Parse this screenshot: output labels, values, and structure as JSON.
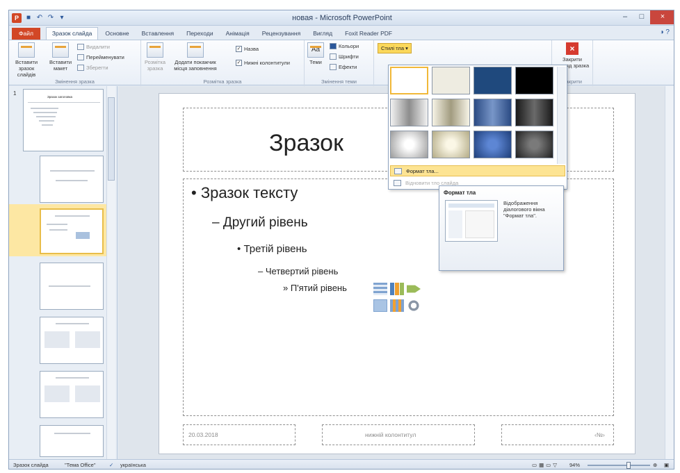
{
  "window": {
    "title": "новая - Microsoft PowerPoint"
  },
  "tabs": [
    "Файл",
    "Зразок слайда",
    "Основне",
    "Вставлення",
    "Переходи",
    "Анімація",
    "Рецензування",
    "Вигляд",
    "Foxit Reader PDF"
  ],
  "ribbon": {
    "insert_master": "Вставити зразок слайдів",
    "insert_layout": "Вставити макет",
    "delete": "Видалити",
    "rename": "Перейменувати",
    "preserve": "Зберегти",
    "group_edit": "Змінення зразка",
    "layout_btn": "Розмітка зразка",
    "insert_placeholder": "Додати покажчик місця заповнення",
    "chk_title": "Назва",
    "chk_footers": "Нижні колонтитули",
    "group_layout": "Розмітка зразка",
    "themes": "Теми",
    "colors": "Кольори",
    "fonts": "Шрифти",
    "effects": "Ефекти",
    "group_theme": "Змінення теми",
    "bg_styles": "Стилі тла",
    "close_view": "Закрити вигляд зразка",
    "group_close": "Закрити"
  },
  "thumbnail": {
    "number": "1",
    "title": "Зразок заголовка"
  },
  "slide": {
    "title": "Зразок",
    "bullets": [
      "Зразок тексту",
      "Другий рівень",
      "Третій рівень",
      "Четвертий рівень",
      "П'ятий рівень"
    ],
    "bullet_marks": [
      "•",
      "–",
      "•",
      "–",
      "»"
    ],
    "date": "20.03.2018",
    "footer": "нижній колонтитул",
    "number": "‹№›"
  },
  "gallery": {
    "format_bg": "Формат тла...",
    "reset_bg": "Відновити тло слайда",
    "swatch_colors": [
      "#ffffff",
      "#eeece1",
      "#1f497d",
      "#000000"
    ]
  },
  "tooltip": {
    "title": "Формат тла",
    "description": "Відображення діалогового вікна \"Формат тла\"."
  },
  "status": {
    "view": "Зразок слайда",
    "theme": "\"Тема Office\"",
    "language": "українська",
    "zoom": "94%"
  },
  "colors": {
    "file_tab": "#d24726",
    "styles_button": "#fbd85b",
    "selection": "#e8bd49"
  }
}
